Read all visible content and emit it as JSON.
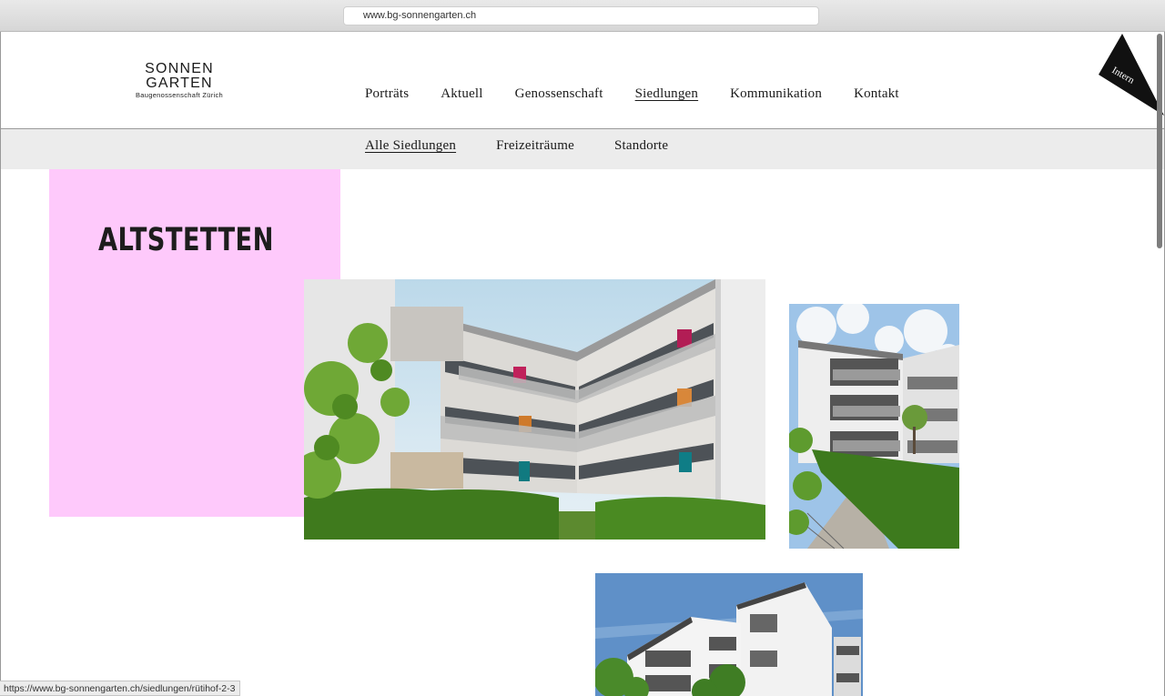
{
  "browser": {
    "url": "www.bg-sonnengarten.ch",
    "status_url": "https://www.bg-sonnengarten.ch/siedlungen/rütihof-2-3"
  },
  "logo": {
    "line1": "SONNEN",
    "line2": "GARTEN",
    "line3": "Baugenossenschaft Zürich"
  },
  "main_nav": [
    {
      "label": "Porträts",
      "active": false
    },
    {
      "label": "Aktuell",
      "active": false
    },
    {
      "label": "Genossenschaft",
      "active": false
    },
    {
      "label": "Siedlungen",
      "active": true
    },
    {
      "label": "Kommunikation",
      "active": false
    },
    {
      "label": "Kontakt",
      "active": false
    }
  ],
  "intern_label": "Intern",
  "sub_nav": [
    {
      "label": "Alle Siedlungen",
      "active": true
    },
    {
      "label": "Freizeiträume",
      "active": false
    },
    {
      "label": "Standorte",
      "active": false
    }
  ],
  "page": {
    "title": "ALTSTETTEN"
  },
  "colors": {
    "accent_pink": "#fec9fb",
    "subnav_bg": "#ececec"
  }
}
